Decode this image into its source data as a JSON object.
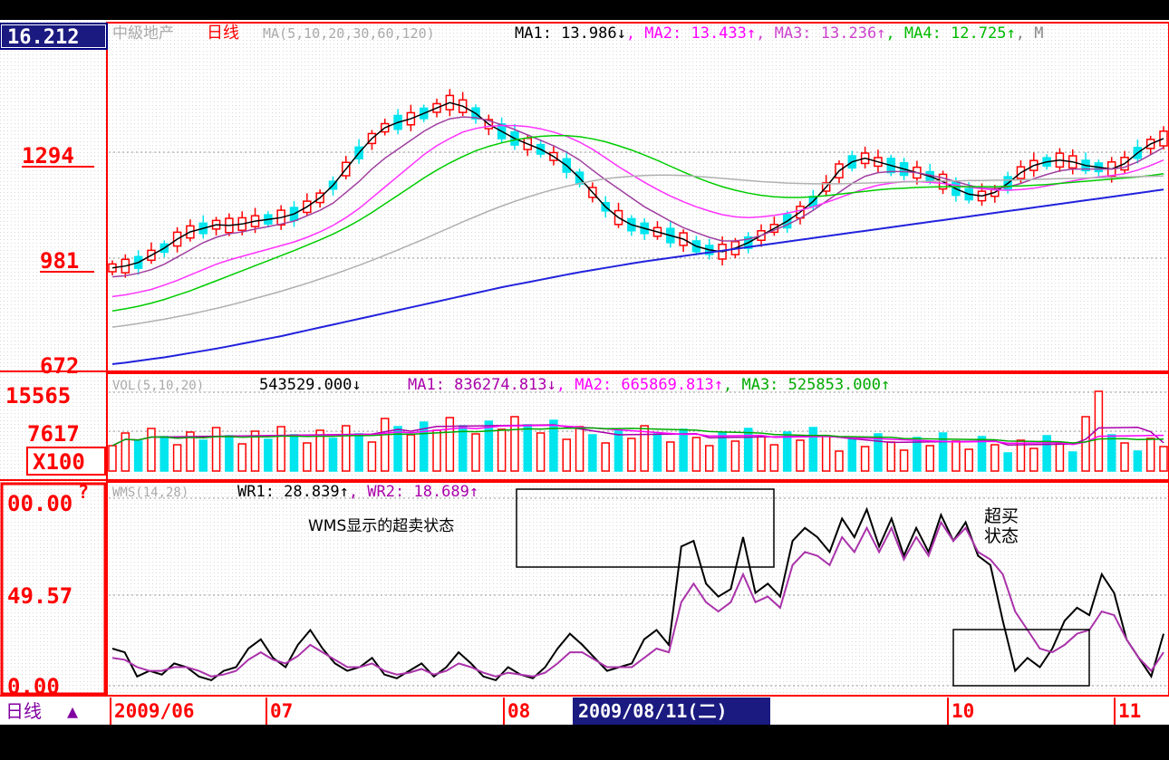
{
  "header": {
    "price_box": "16.212",
    "stock_name": "中級地产",
    "period_label": "日线",
    "ma_params": "MA(5,10,20,30,60,120)",
    "ma_readings": [
      {
        "label": "MA1:",
        "value": "13.986",
        "arrow": "↓",
        "color": "#000000"
      },
      {
        "label": "MA2:",
        "value": "13.433",
        "arrow": "↑",
        "color": "#ff00ff"
      },
      {
        "label": "MA3:",
        "value": "13.236",
        "arrow": "↑",
        "color": "#cc44cc"
      },
      {
        "label": "MA4:",
        "value": "12.725",
        "arrow": "↑",
        "color": "#00bb00"
      },
      {
        "label": "M",
        "value": "",
        "arrow": "",
        "color": "#888888"
      }
    ]
  },
  "volume_header": {
    "params": "VOL(5,10,20)",
    "value": "543529.000",
    "value_arrow": "↓",
    "readings": [
      {
        "label": "MA1:",
        "value": "836274.813",
        "arrow": "↓",
        "color": "#aa00aa"
      },
      {
        "label": "MA2:",
        "value": "665869.813",
        "arrow": "↑",
        "color": "#ff00ff"
      },
      {
        "label": "MA3:",
        "value": "525853.000",
        "arrow": "↑",
        "color": "#00aa00"
      }
    ]
  },
  "wms_header": {
    "params": "WMS(14,28)",
    "readings": [
      {
        "label": "WR1:",
        "value": "28.839",
        "arrow": "↑",
        "color": "#000000"
      },
      {
        "label": "WR2:",
        "value": "18.689",
        "arrow": "↑",
        "color": "#aa00aa"
      }
    ]
  },
  "annotations": {
    "oversold_text": "WMS显示的超卖状态",
    "overbought_line1": "超买",
    "overbought_line2": "状态"
  },
  "footer": {
    "period_label": "日线",
    "period_arrow": "▲",
    "dates": [
      "2009/06",
      "07",
      "08",
      "10",
      "11"
    ],
    "cursor_date": "2009/08/11(二)"
  },
  "colors": {
    "up": "#ff0000",
    "down": "#00e5ee",
    "ma1": "#000000",
    "ma2": "#a040a0",
    "ma3": "#ff33ff",
    "ma4": "#00cc00",
    "ma5": "#b0b0b0",
    "ma6": "#2222dd",
    "wr1": "#000000",
    "wr2": "#aa33aa",
    "frame": "#ff0000"
  },
  "chart_data": [
    {
      "type": "candlestick",
      "title": "",
      "y_ticks": [
        "1294",
        "981",
        "672"
      ],
      "ylim": [
        672,
        1620
      ],
      "series": [
        {
          "name": "MA1",
          "values": [
            940,
            945,
            955,
            975,
            995,
            1020,
            1040,
            1050,
            1060,
            1058,
            1062,
            1070,
            1075,
            1080,
            1090,
            1110,
            1135,
            1170,
            1215,
            1260,
            1300,
            1330,
            1345,
            1355,
            1370,
            1385,
            1400,
            1390,
            1370,
            1340,
            1320,
            1300,
            1285,
            1270,
            1250,
            1225,
            1190,
            1150,
            1110,
            1080,
            1060,
            1050,
            1040,
            1030,
            1020,
            1000,
            990,
            985,
            995,
            1010,
            1030,
            1050,
            1070,
            1095,
            1125,
            1165,
            1210,
            1235,
            1245,
            1235,
            1225,
            1215,
            1205,
            1195,
            1180,
            1160,
            1145,
            1140,
            1150,
            1175,
            1205,
            1225,
            1235,
            1240,
            1235,
            1225,
            1220,
            1215,
            1230,
            1260,
            1285,
            1300
          ]
        },
        {
          "name": "MA2",
          "values": [
            915,
            918,
            925,
            935,
            950,
            970,
            990,
            1010,
            1025,
            1035,
            1040,
            1048,
            1055,
            1062,
            1070,
            1085,
            1100,
            1120,
            1150,
            1180,
            1215,
            1245,
            1270,
            1295,
            1320,
            1340,
            1355,
            1360,
            1358,
            1350,
            1338,
            1325,
            1310,
            1295,
            1280,
            1262,
            1240,
            1212,
            1185,
            1160,
            1135,
            1110,
            1090,
            1070,
            1052,
            1038,
            1025,
            1015,
            1015,
            1020,
            1030,
            1045,
            1060,
            1078,
            1100,
            1125,
            1150,
            1175,
            1195,
            1205,
            1208,
            1208,
            1205,
            1198,
            1190,
            1180,
            1170,
            1162,
            1160,
            1165,
            1175,
            1188,
            1200,
            1210,
            1215,
            1215,
            1215,
            1215,
            1220,
            1235,
            1255,
            1275
          ]
        },
        {
          "name": "MA3",
          "values": [
            860,
            865,
            872,
            880,
            892,
            905,
            920,
            935,
            950,
            962,
            972,
            982,
            992,
            1002,
            1012,
            1025,
            1040,
            1058,
            1080,
            1105,
            1135,
            1165,
            1195,
            1225,
            1255,
            1280,
            1300,
            1318,
            1328,
            1334,
            1336,
            1336,
            1333,
            1327,
            1318,
            1306,
            1290,
            1270,
            1246,
            1222,
            1200,
            1178,
            1158,
            1140,
            1124,
            1110,
            1098,
            1088,
            1082,
            1080,
            1082,
            1086,
            1092,
            1100,
            1110,
            1122,
            1135,
            1148,
            1160,
            1170,
            1176,
            1180,
            1180,
            1178,
            1175,
            1170,
            1165,
            1160,
            1157,
            1156,
            1158,
            1162,
            1168,
            1175,
            1182,
            1188,
            1193,
            1197,
            1202,
            1212,
            1225,
            1240
          ]
        },
        {
          "name": "MA4",
          "values": [
            820,
            826,
            833,
            842,
            852,
            864,
            876,
            890,
            904,
            918,
            932,
            946,
            960,
            974,
            988,
            1003,
            1018,
            1034,
            1052,
            1072,
            1094,
            1118,
            1142,
            1166,
            1190,
            1212,
            1232,
            1250,
            1266,
            1278,
            1288,
            1296,
            1302,
            1306,
            1308,
            1308,
            1305,
            1299,
            1291,
            1280,
            1268,
            1254,
            1239,
            1223,
            1207,
            1192,
            1178,
            1166,
            1156,
            1148,
            1142,
            1138,
            1136,
            1136,
            1138,
            1141,
            1145,
            1149,
            1153,
            1157,
            1160,
            1162,
            1164,
            1165,
            1166,
            1166,
            1166,
            1166,
            1166,
            1167,
            1168,
            1170,
            1172,
            1175,
            1178,
            1181,
            1184,
            1187,
            1190,
            1193,
            1197,
            1202
          ]
        },
        {
          "name": "MA5",
          "values": [
            775,
            780,
            785,
            791,
            797,
            804,
            811,
            819,
            827,
            836,
            845,
            855,
            865,
            875,
            886,
            897,
            909,
            921,
            934,
            947,
            961,
            975,
            990,
            1005,
            1020,
            1036,
            1052,
            1068,
            1083,
            1098,
            1112,
            1125,
            1137,
            1148,
            1158,
            1167,
            1175,
            1182,
            1188,
            1192,
            1195,
            1197,
            1198,
            1198,
            1197,
            1195,
            1192,
            1189,
            1186,
            1183,
            1180,
            1178,
            1176,
            1175,
            1174,
            1174,
            1174,
            1175,
            1176,
            1177,
            1178,
            1179,
            1180,
            1181,
            1182,
            1182,
            1183,
            1183,
            1184,
            1184,
            1185,
            1186,
            1187,
            1188,
            1189,
            1190,
            1191,
            1192,
            1193,
            1194,
            1195,
            1196
          ]
        },
        {
          "name": "MA6",
          "values": [
            672,
            676,
            681,
            686,
            691,
            697,
            703,
            709,
            715,
            722,
            729,
            736,
            743,
            750,
            758,
            766,
            774,
            782,
            790,
            798,
            806,
            814,
            822,
            830,
            838,
            846,
            854,
            862,
            870,
            878,
            886,
            893,
            900,
            907,
            914,
            921,
            928,
            934,
            940,
            946,
            952,
            958,
            963,
            968,
            973,
            978,
            983,
            988,
            993,
            998,
            1003,
            1008,
            1013,
            1018,
            1023,
            1028,
            1033,
            1038,
            1043,
            1048,
            1053,
            1058,
            1063,
            1068,
            1073,
            1078,
            1083,
            1088,
            1093,
            1098,
            1103,
            1108,
            1113,
            1118,
            1123,
            1128,
            1133,
            1138,
            1143,
            1148,
            1153,
            1158
          ]
        }
      ]
    },
    {
      "type": "bar",
      "title": "",
      "y_ticks": [
        "15565",
        "7617"
      ],
      "unit_label": "X100"
    },
    {
      "type": "line",
      "title": "",
      "y_ticks": [
        "00.00",
        "49.57",
        "0.00"
      ],
      "y_marker": "?",
      "series": [
        {
          "name": "WR1",
          "values": [
            20,
            18,
            5,
            8,
            6,
            12,
            10,
            5,
            3,
            8,
            10,
            20,
            25,
            15,
            10,
            22,
            30,
            20,
            12,
            8,
            10,
            15,
            6,
            4,
            8,
            12,
            5,
            10,
            18,
            12,
            5,
            3,
            10,
            6,
            4,
            10,
            20,
            28,
            22,
            15,
            8,
            10,
            12,
            25,
            30,
            22,
            75,
            78,
            55,
            48,
            52,
            80,
            50,
            55,
            48,
            78,
            85,
            80,
            72,
            90,
            80,
            95,
            75,
            90,
            70,
            85,
            72,
            92,
            78,
            88,
            70,
            65,
            35,
            8,
            15,
            10,
            20,
            35,
            42,
            38,
            60,
            50,
            25,
            15,
            5,
            28
          ]
        },
        {
          "name": "WR2",
          "values": [
            15,
            14,
            10,
            8,
            8,
            10,
            10,
            8,
            5,
            6,
            8,
            14,
            18,
            14,
            12,
            16,
            22,
            18,
            14,
            10,
            10,
            12,
            8,
            6,
            7,
            9,
            6,
            8,
            12,
            10,
            7,
            5,
            7,
            6,
            5,
            7,
            12,
            18,
            18,
            14,
            10,
            10,
            10,
            15,
            20,
            18,
            45,
            55,
            45,
            40,
            45,
            60,
            45,
            48,
            42,
            65,
            72,
            70,
            65,
            80,
            72,
            85,
            72,
            85,
            68,
            80,
            70,
            88,
            78,
            85,
            72,
            68,
            60,
            40,
            30,
            20,
            18,
            22,
            28,
            30,
            40,
            38,
            25,
            15,
            8,
            18
          ]
        }
      ]
    }
  ]
}
